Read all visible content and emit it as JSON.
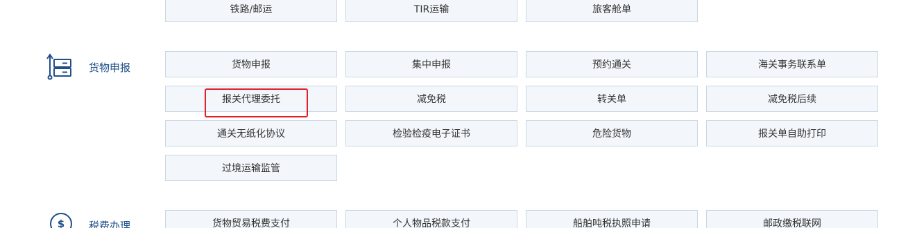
{
  "top_row": [
    "铁路/邮运",
    "TIR运输",
    "旅客舱单"
  ],
  "sections": [
    {
      "label": "货物申报",
      "icon": "server-stack-icon",
      "items": [
        "货物申报",
        "集中申报",
        "预约通关",
        "海关事务联系单",
        "报关代理委托",
        "减免税",
        "转关单",
        "减免税后续",
        "通关无纸化协议",
        "检验检疫电子证书",
        "危险货物",
        "报关单自助打印",
        "过境运输监管"
      ]
    },
    {
      "label": "税费办理",
      "icon": "dollar-circle-icon",
      "items": [
        "货物贸易税费支付",
        "个人物品税款支付",
        "船舶吨税执照申请",
        "邮政缴税联网"
      ]
    }
  ],
  "highlighted_item": "报关代理委托",
  "colors": {
    "tile_bg": "#f3f7fb",
    "tile_border": "#c9d7e4",
    "accent": "#1e4f8a",
    "highlight": "#e0202a"
  }
}
